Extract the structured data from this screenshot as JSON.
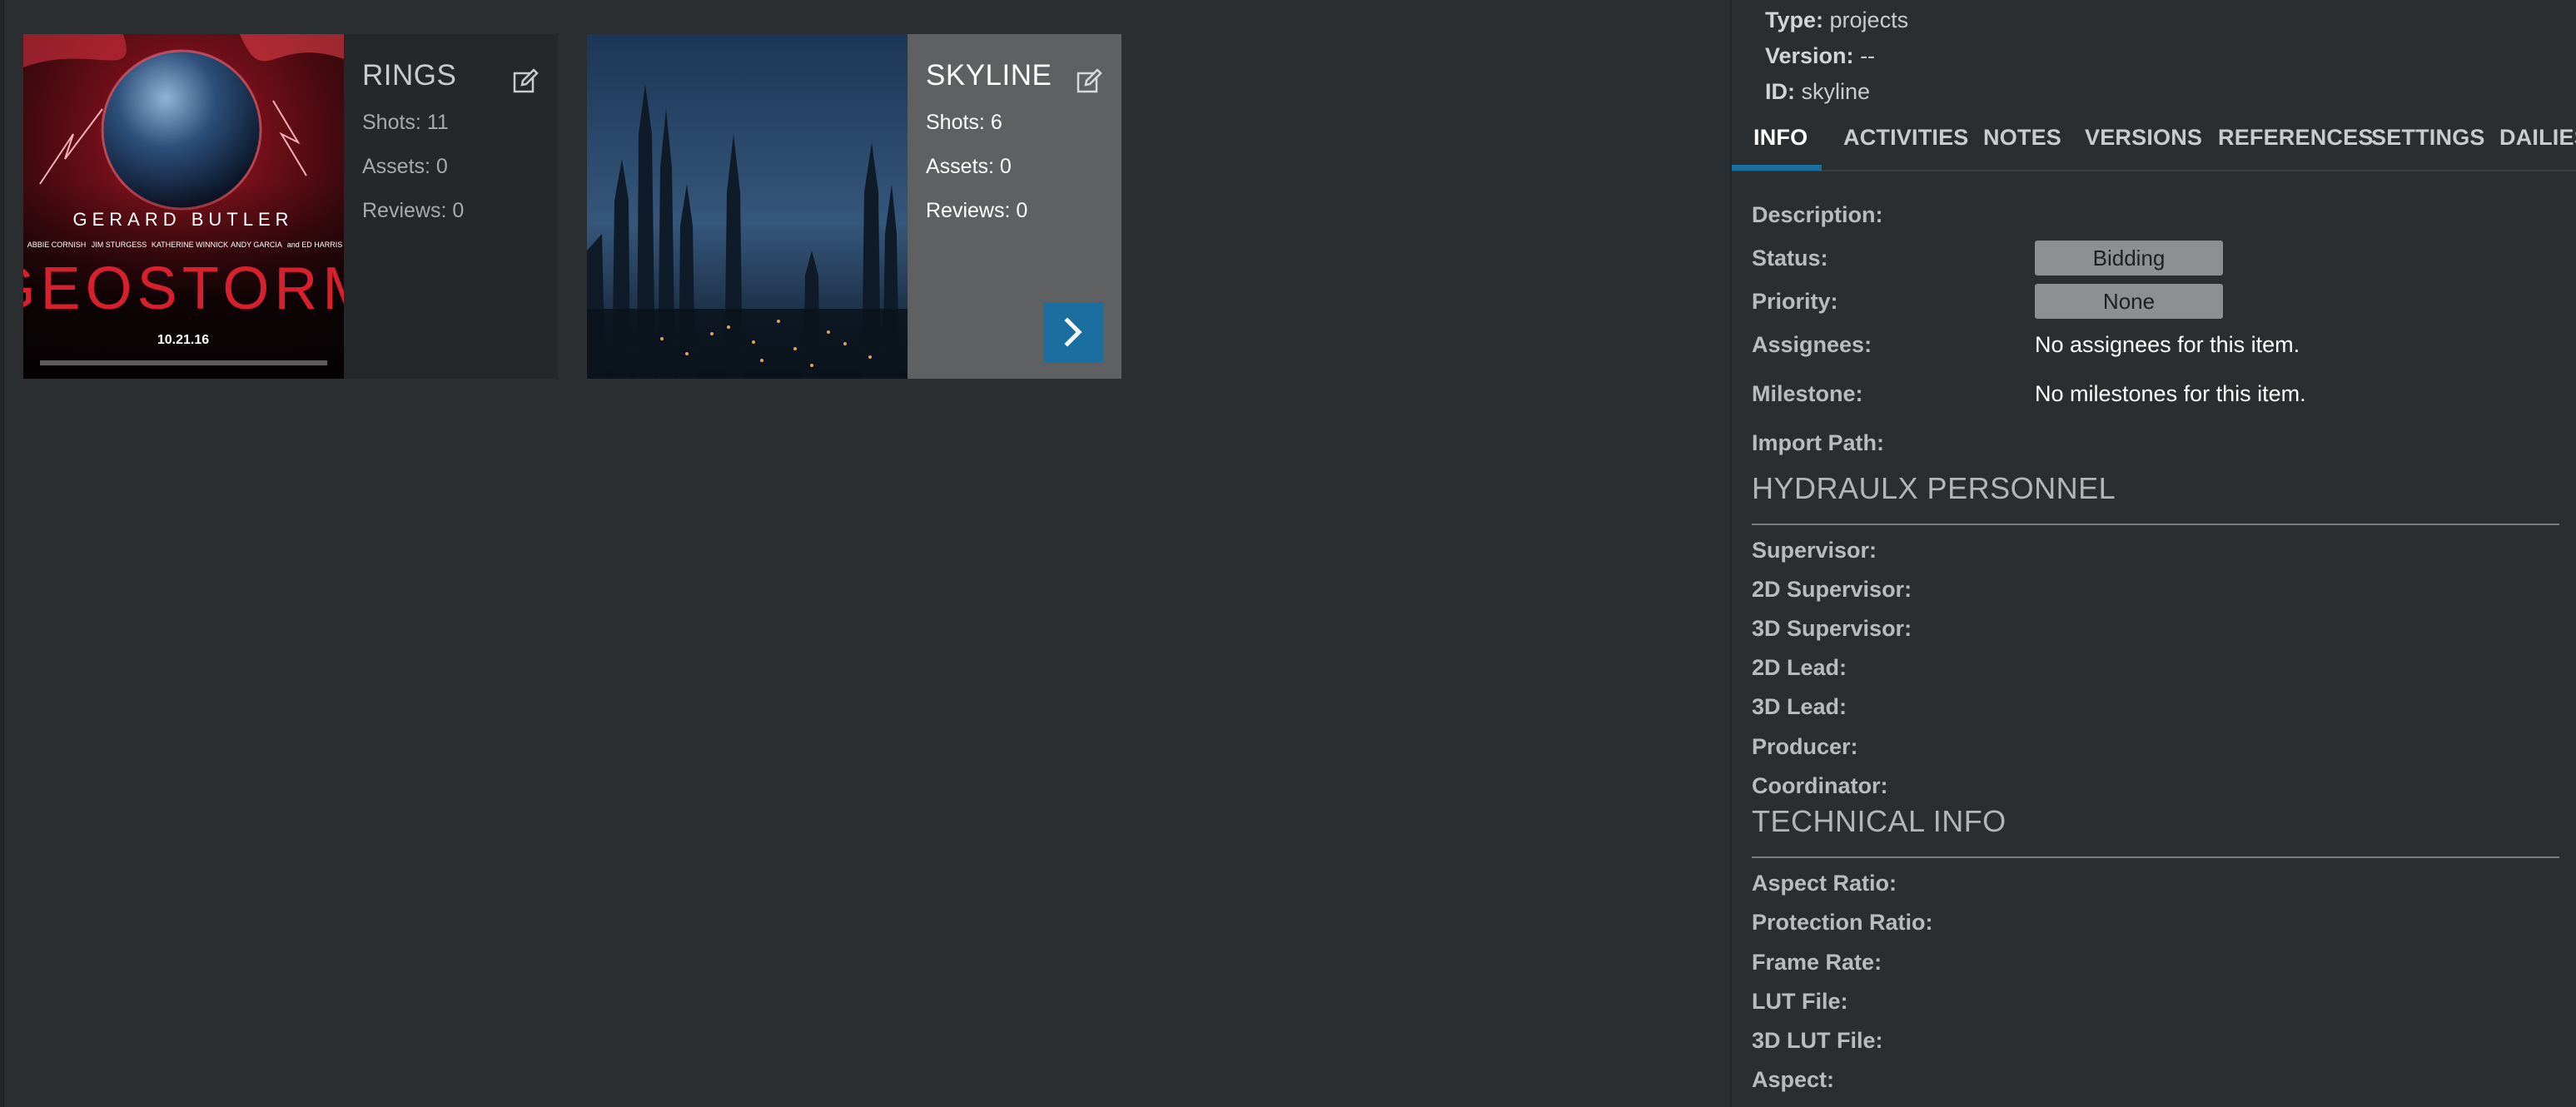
{
  "cards": [
    {
      "title": "RINGS",
      "shots": "Shots: 11",
      "assets": "Assets: 0",
      "reviews": "Reviews: 0",
      "poster": {
        "names_top": "GERARD BUTLER",
        "names_small": [
          "ABBIE CORNISH",
          "JIM STURGESS",
          "KATHERINE WINNICK",
          "ANDY GARCIA",
          "and ED HARRIS"
        ],
        "movie_title": "GEOSTORM",
        "release_date": "10.21.16"
      }
    },
    {
      "title": "SKYLINE",
      "shots": "Shots: 6",
      "assets": "Assets: 0",
      "reviews": "Reviews: 0"
    }
  ],
  "panel": {
    "type_label": "Type:",
    "type_value": "projects",
    "version_label": "Version:",
    "version_value": "--",
    "id_label": "ID:",
    "id_value": "skyline",
    "tabs": [
      "INFO",
      "ACTIVITIES",
      "NOTES",
      "VERSIONS",
      "REFERENCES",
      "SETTINGS",
      "DAILIES"
    ],
    "active_tab": "INFO",
    "fields": {
      "description": "Description:",
      "status": "Status:",
      "status_value": "Bidding",
      "priority": "Priority:",
      "priority_value": "None",
      "assignees": "Assignees:",
      "assignees_value": "No assignees for this item.",
      "milestone": "Milestone:",
      "milestone_value": "No milestones for this item.",
      "import_path": "Import Path:"
    },
    "personnel_title": "HYDRAULX PERSONNEL",
    "personnel": [
      "Supervisor:",
      "2D Supervisor:",
      "3D Supervisor:",
      "2D Lead:",
      "3D Lead:",
      "Producer:",
      "Coordinator:"
    ],
    "technical_title": "TECHNICAL INFO",
    "technical": [
      "Aspect Ratio:",
      "Protection Ratio:",
      "Frame Rate:",
      "LUT File:",
      "3D LUT File:",
      "Aspect:"
    ]
  },
  "colors": {
    "background": "#2b2e30",
    "accent": "#1b6fa0",
    "pill": "#8d8f90"
  }
}
